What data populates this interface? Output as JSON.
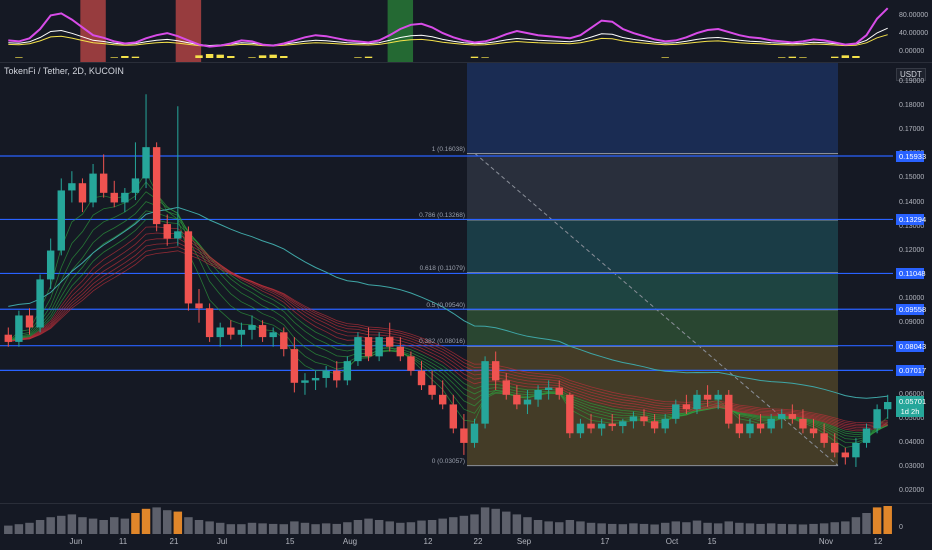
{
  "chart_title": "TokenFi / Tether, 2D, KUCOIN",
  "currency": "USDT",
  "colors": {
    "background": "#151924",
    "up": "#26a69a",
    "down": "#ef5350",
    "fib_line": "#2962ff",
    "oscillator": "#d84ce8",
    "bands": "#2e9e3d"
  },
  "price_axis_labels": [
    "0.19000",
    "0.18000",
    "0.17000",
    "0.16000",
    "0.15000",
    "0.14000",
    "0.13000",
    "0.12000",
    "0.11000",
    "0.10000",
    "0.09000",
    "0.08000",
    "0.07000",
    "0.06000",
    "0.05000",
    "0.04000",
    "0.03000",
    "0.02000"
  ],
  "indicator_axis_labels": [
    "80.00000",
    "40.00000",
    "0.00000"
  ],
  "volume_axis_label": "0",
  "price_tags": [
    {
      "value": "0.15933",
      "color": "#2962ff"
    },
    {
      "value": "0.13294",
      "color": "#2962ff"
    },
    {
      "value": "0.11048",
      "color": "#2962ff"
    },
    {
      "value": "0.09558",
      "color": "#2962ff"
    },
    {
      "value": "0.08043",
      "color": "#2962ff"
    },
    {
      "value": "0.07017",
      "color": "#2962ff"
    },
    {
      "value": "0.05701",
      "color": "#26a69a"
    },
    {
      "value": "1d 2h",
      "color": "#26a69a"
    }
  ],
  "fib_levels": [
    {
      "label": "1 (0.16038)",
      "price": 0.16038
    },
    {
      "label": "0.786 (0.13268)",
      "price": 0.13268
    },
    {
      "label": "0.618 (0.11079)",
      "price": 0.11079
    },
    {
      "label": "0.5 (0.09540)",
      "price": 0.0954
    },
    {
      "label": "0.382 (0.08016)",
      "price": 0.08016
    },
    {
      "label": "0 (0.03057)",
      "price": 0.03057
    }
  ],
  "time_labels": [
    "Jun",
    "11",
    "21",
    "Jul",
    "15",
    "Aug",
    "12",
    "22",
    "Sep",
    "17",
    "Oct",
    "15",
    "Nov",
    "12"
  ],
  "horizontal_lines": [
    0.15933,
    0.13294,
    0.11048,
    0.09558,
    0.08043,
    0.07017
  ],
  "chart_data": {
    "type": "candlestick",
    "y_axis_range": [
      0.015,
      0.198
    ],
    "candles": [
      [
        0.085,
        0.088,
        0.08,
        0.082
      ],
      [
        0.082,
        0.095,
        0.08,
        0.093
      ],
      [
        0.093,
        0.096,
        0.085,
        0.088
      ],
      [
        0.088,
        0.11,
        0.086,
        0.108
      ],
      [
        0.108,
        0.125,
        0.104,
        0.12
      ],
      [
        0.12,
        0.15,
        0.118,
        0.145
      ],
      [
        0.145,
        0.153,
        0.14,
        0.148
      ],
      [
        0.148,
        0.15,
        0.136,
        0.14
      ],
      [
        0.14,
        0.156,
        0.138,
        0.152
      ],
      [
        0.152,
        0.16,
        0.142,
        0.144
      ],
      [
        0.144,
        0.149,
        0.138,
        0.14
      ],
      [
        0.14,
        0.146,
        0.136,
        0.144
      ],
      [
        0.144,
        0.165,
        0.141,
        0.15
      ],
      [
        0.15,
        0.185,
        0.146,
        0.163
      ],
      [
        0.163,
        0.165,
        0.128,
        0.131
      ],
      [
        0.131,
        0.135,
        0.122,
        0.125
      ],
      [
        0.125,
        0.18,
        0.122,
        0.128
      ],
      [
        0.128,
        0.13,
        0.095,
        0.098
      ],
      [
        0.098,
        0.104,
        0.09,
        0.096
      ],
      [
        0.096,
        0.098,
        0.082,
        0.084
      ],
      [
        0.084,
        0.09,
        0.08,
        0.088
      ],
      [
        0.088,
        0.091,
        0.083,
        0.085
      ],
      [
        0.085,
        0.09,
        0.08,
        0.087
      ],
      [
        0.087,
        0.093,
        0.083,
        0.089
      ],
      [
        0.089,
        0.091,
        0.082,
        0.084
      ],
      [
        0.084,
        0.088,
        0.08,
        0.086
      ],
      [
        0.086,
        0.088,
        0.076,
        0.079
      ],
      [
        0.079,
        0.084,
        0.061,
        0.065
      ],
      [
        0.065,
        0.069,
        0.06,
        0.066
      ],
      [
        0.066,
        0.07,
        0.062,
        0.067
      ],
      [
        0.067,
        0.072,
        0.063,
        0.07
      ],
      [
        0.07,
        0.074,
        0.063,
        0.066
      ],
      [
        0.066,
        0.076,
        0.064,
        0.074
      ],
      [
        0.074,
        0.086,
        0.072,
        0.084
      ],
      [
        0.084,
        0.088,
        0.074,
        0.076
      ],
      [
        0.076,
        0.086,
        0.074,
        0.084
      ],
      [
        0.084,
        0.09,
        0.078,
        0.08
      ],
      [
        0.08,
        0.084,
        0.074,
        0.076
      ],
      [
        0.076,
        0.078,
        0.068,
        0.07
      ],
      [
        0.07,
        0.074,
        0.062,
        0.064
      ],
      [
        0.064,
        0.07,
        0.058,
        0.06
      ],
      [
        0.06,
        0.066,
        0.054,
        0.056
      ],
      [
        0.056,
        0.06,
        0.044,
        0.046
      ],
      [
        0.046,
        0.052,
        0.035,
        0.04
      ],
      [
        0.04,
        0.05,
        0.038,
        0.048
      ],
      [
        0.048,
        0.076,
        0.046,
        0.074
      ],
      [
        0.074,
        0.078,
        0.062,
        0.066
      ],
      [
        0.066,
        0.069,
        0.058,
        0.06
      ],
      [
        0.06,
        0.064,
        0.054,
        0.056
      ],
      [
        0.056,
        0.062,
        0.052,
        0.058
      ],
      [
        0.058,
        0.064,
        0.055,
        0.062
      ],
      [
        0.062,
        0.066,
        0.058,
        0.063
      ],
      [
        0.063,
        0.066,
        0.058,
        0.06
      ],
      [
        0.06,
        0.061,
        0.042,
        0.044
      ],
      [
        0.044,
        0.05,
        0.042,
        0.048
      ],
      [
        0.048,
        0.052,
        0.044,
        0.046
      ],
      [
        0.046,
        0.05,
        0.043,
        0.048
      ],
      [
        0.048,
        0.052,
        0.045,
        0.047
      ],
      [
        0.047,
        0.05,
        0.044,
        0.049
      ],
      [
        0.049,
        0.053,
        0.046,
        0.051
      ],
      [
        0.051,
        0.054,
        0.047,
        0.049
      ],
      [
        0.049,
        0.052,
        0.044,
        0.046
      ],
      [
        0.046,
        0.052,
        0.044,
        0.05
      ],
      [
        0.05,
        0.058,
        0.048,
        0.056
      ],
      [
        0.056,
        0.06,
        0.052,
        0.054
      ],
      [
        0.054,
        0.062,
        0.052,
        0.06
      ],
      [
        0.06,
        0.064,
        0.055,
        0.058
      ],
      [
        0.058,
        0.062,
        0.054,
        0.06
      ],
      [
        0.06,
        0.062,
        0.046,
        0.048
      ],
      [
        0.048,
        0.052,
        0.042,
        0.044
      ],
      [
        0.044,
        0.05,
        0.042,
        0.048
      ],
      [
        0.048,
        0.052,
        0.044,
        0.046
      ],
      [
        0.046,
        0.052,
        0.044,
        0.05
      ],
      [
        0.05,
        0.054,
        0.046,
        0.052
      ],
      [
        0.052,
        0.056,
        0.048,
        0.05
      ],
      [
        0.05,
        0.054,
        0.044,
        0.046
      ],
      [
        0.046,
        0.05,
        0.042,
        0.044
      ],
      [
        0.044,
        0.048,
        0.038,
        0.04
      ],
      [
        0.04,
        0.044,
        0.034,
        0.036
      ],
      [
        0.036,
        0.038,
        0.031,
        0.034
      ],
      [
        0.034,
        0.042,
        0.03,
        0.04
      ],
      [
        0.04,
        0.048,
        0.038,
        0.046
      ],
      [
        0.046,
        0.056,
        0.044,
        0.054
      ],
      [
        0.054,
        0.06,
        0.05,
        0.057
      ]
    ],
    "volume": [
      0.3,
      0.35,
      0.4,
      0.5,
      0.6,
      0.65,
      0.7,
      0.6,
      0.55,
      0.5,
      0.6,
      0.55,
      0.75,
      0.9,
      0.95,
      0.85,
      0.8,
      0.6,
      0.5,
      0.45,
      0.4,
      0.35,
      0.35,
      0.4,
      0.38,
      0.36,
      0.35,
      0.45,
      0.4,
      0.35,
      0.38,
      0.36,
      0.42,
      0.5,
      0.55,
      0.5,
      0.45,
      0.4,
      0.42,
      0.48,
      0.5,
      0.55,
      0.6,
      0.65,
      0.7,
      0.95,
      0.9,
      0.8,
      0.7,
      0.6,
      0.5,
      0.45,
      0.42,
      0.5,
      0.45,
      0.4,
      0.38,
      0.36,
      0.35,
      0.38,
      0.36,
      0.34,
      0.4,
      0.45,
      0.42,
      0.48,
      0.4,
      0.38,
      0.45,
      0.4,
      0.38,
      0.36,
      0.38,
      0.36,
      0.35,
      0.34,
      0.36,
      0.38,
      0.42,
      0.45,
      0.6,
      0.75,
      0.95,
      1.0
    ],
    "volume_highlight": [
      12,
      13,
      16,
      82,
      83
    ],
    "oscillator": [
      30,
      28,
      34,
      52,
      78,
      82,
      70,
      55,
      40,
      35,
      28,
      24,
      26,
      34,
      40,
      44,
      38,
      30,
      22,
      18,
      20,
      24,
      30,
      28,
      22,
      20,
      24,
      30,
      36,
      40,
      38,
      34,
      30,
      28,
      26,
      30,
      40,
      52,
      60,
      62,
      55,
      44,
      36,
      30,
      26,
      28,
      34,
      42,
      48,
      44,
      40,
      38,
      36,
      34,
      40,
      54,
      68,
      66,
      52,
      44,
      38,
      32,
      28,
      30,
      36,
      44,
      50,
      52,
      46,
      40,
      36,
      34,
      30,
      28,
      26,
      28,
      32,
      30,
      26,
      22,
      24,
      40,
      72,
      92
    ],
    "indicator_columns": [
      [
        8,
        "#ef5350"
      ],
      [
        17,
        "#ef5350"
      ],
      [
        37,
        "#2e9e3d"
      ]
    ]
  }
}
